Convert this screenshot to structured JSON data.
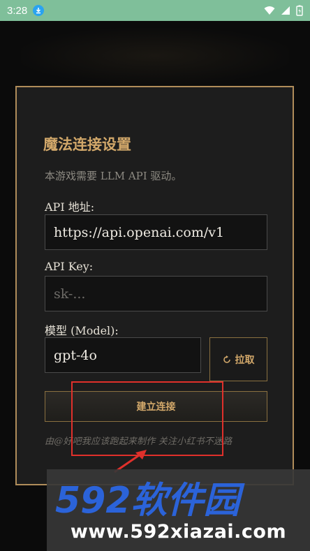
{
  "status_bar": {
    "time": "3:28"
  },
  "dialog": {
    "title": "魔法连接设置",
    "description": "本游戏需要 LLM API 驱动。",
    "api_address_label": "API 地址:",
    "api_address_value": "https://api.openai.com/v1",
    "api_key_label": "API Key:",
    "api_key_placeholder": "sk-...",
    "model_label": "模型 (Model):",
    "model_value": "gpt-4o",
    "fetch_button": "拉取",
    "connect_button": "建立连接",
    "footer_note": "由@好吧我应该跑起来制作 关注小红书不迷路"
  },
  "watermark": {
    "brand": "592软件园",
    "url": "www.592xiazai.com"
  },
  "colors": {
    "accent_gold": "#d2a86a",
    "border_gold": "#b08d5a",
    "status_bar": "#7fbf9a",
    "highlight_red": "#e0302b",
    "watermark_blue": "#2b63d9"
  }
}
